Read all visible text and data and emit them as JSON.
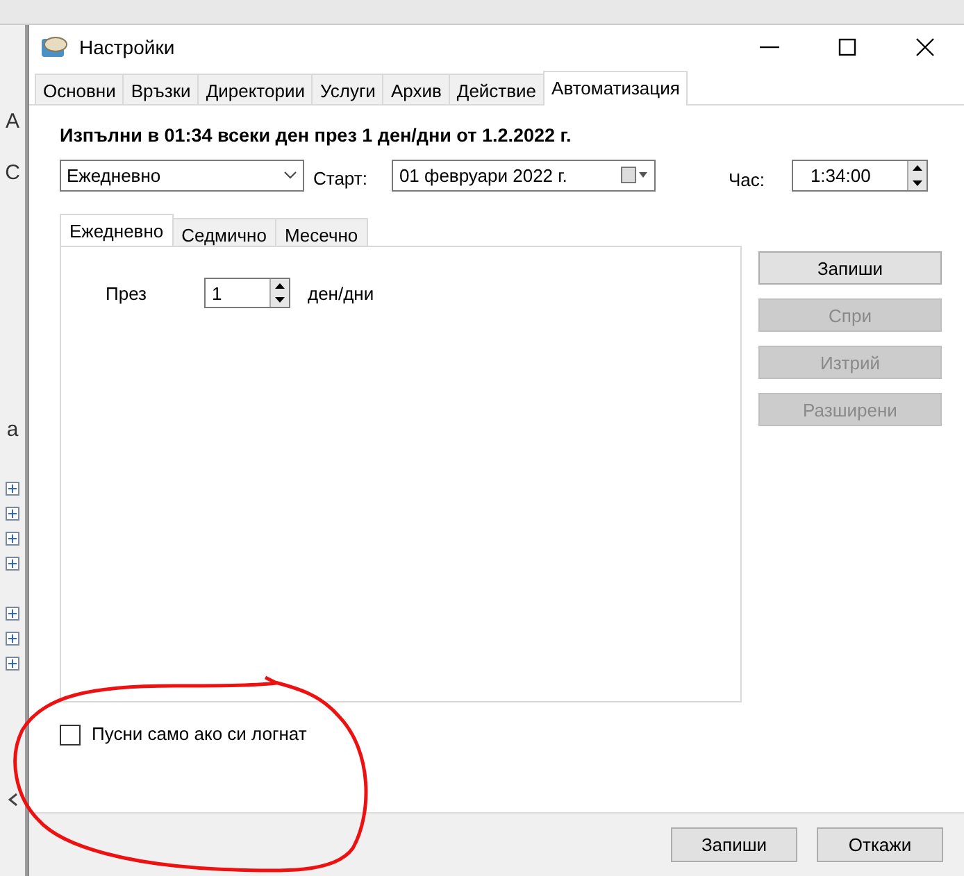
{
  "background_window": {
    "fragments": [
      "А",
      "С",
      "а"
    ],
    "tree_nodes": [
      {
        "expanded": false
      },
      {
        "expanded": false
      },
      {
        "expanded": false
      },
      {
        "expanded": false
      },
      {
        "expanded": false
      },
      {
        "expanded": false
      },
      {
        "expanded": false
      }
    ]
  },
  "window": {
    "title": "Настройки"
  },
  "tabs": [
    {
      "label": "Основни",
      "selected": false
    },
    {
      "label": "Връзки",
      "selected": false
    },
    {
      "label": "Директории",
      "selected": false
    },
    {
      "label": "Услуги",
      "selected": false
    },
    {
      "label": "Архив",
      "selected": false
    },
    {
      "label": "Действие",
      "selected": false
    },
    {
      "label": "Автоматизация",
      "selected": true
    }
  ],
  "summary": "Изпълни в 01:34 всеки ден през 1 ден/дни от 1.2.2022 г.",
  "schedule": {
    "frequency": "Ежедневно",
    "start_label": "Старт:",
    "start_date": "01  февруари  2022 г.",
    "time_label": "Час:",
    "time": "1:34:00"
  },
  "sub_tabs": [
    {
      "label": "Ежедневно",
      "selected": true
    },
    {
      "label": "Седмично",
      "selected": false
    },
    {
      "label": "Месечно",
      "selected": false
    }
  ],
  "daily": {
    "label": "През",
    "value": "1",
    "unit": "ден/дни"
  },
  "side_buttons": [
    {
      "label": "Запиши",
      "disabled": false
    },
    {
      "label": "Спри",
      "disabled": true
    },
    {
      "label": "Изтрий",
      "disabled": true
    },
    {
      "label": "Разширени",
      "disabled": true
    }
  ],
  "run_only_logged_in": {
    "label": "Пусни само ако си логнат",
    "checked": false
  },
  "footer_buttons": [
    "Запиши",
    "Откажи"
  ]
}
